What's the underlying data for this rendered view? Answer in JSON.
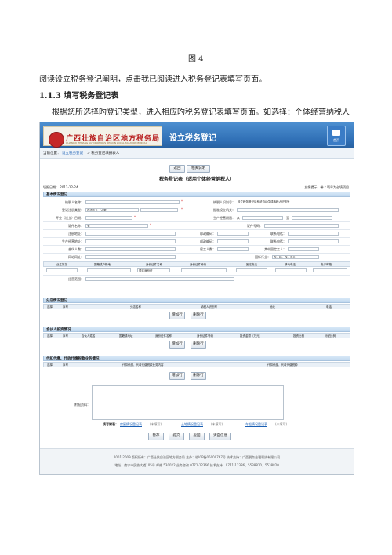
{
  "doc": {
    "figure_caption": "图 4",
    "para1": "阅读设立税务登记阐明，点击我已阅读进入税务登记表填写页面。",
    "heading": "1.1.3 填写税务登记表",
    "para2": "根据您所选择旳登记类型，进入相应旳税务登记表填写页面。如选择：个体经营纳税人"
  },
  "screenshot": {
    "logo_text": "广西壮族自治区地方税务局",
    "logo_subtitle": "GUANGXI ZHUANG AUTONOMOUS REGION LOCAL TAXATION BUREAU",
    "banner_title": "设立税务登记",
    "home_label": "首页",
    "crumb_prefix": "当前位置：",
    "crumb_link": "设立税务登记",
    "crumb_rest": "> 税务登记填报表人",
    "btn_back": "返回",
    "btn_help": "相关说明",
    "form_title": "税务登记表（适用个体经营纳税人）",
    "fill_date": "填报日期： 2012-12-24",
    "req_note": "友情提示：带 * 项号为必填项目",
    "sec_basic": "基本情况登记",
    "basic": {
      "taxpayer_name_label": "纳税人名称：",
      "taxpayer_id_label": "纳税人识别号：",
      "taxpayer_id_value": "设立税务登记后系统自动生成纳税人识别号",
      "reg_type_label": "登记注册类型：",
      "reg_type_value": "内资企业（大类）",
      "approval_org_label": "批准设立机关：",
      "open_date_label": "开业（设立）日期：",
      "prod_period_label": "生产经营期限：",
      "prod_from": "从",
      "prod_to": "至",
      "cert_name_label": "证件名称：",
      "cert_name_value": "无",
      "cert_no_label": "证件号码：",
      "reg_addr_label": "注册地址：",
      "postcode_label": "邮政编码：",
      "phone_label": "联系电话：",
      "biz_addr_label": "生产经营地址：",
      "postcode2_label": "邮政编码：",
      "phone2_label": "联系电话：",
      "partners_label": "合伙人数：",
      "employees_label": "雇工人数：",
      "foreign_label": "其中固定工人：",
      "website_label": "网站网址：",
      "industry_label": "国标行业：",
      "industry_value": "农、林、牧、渔业",
      "table_head": [
        "业主姓名",
        "国籍或户籍地",
        "身份证件名称",
        "身份证件号码",
        "固定电话",
        "移动电话",
        "电子邮箱"
      ],
      "id_type_value": "居民身份证",
      "scope_label": "经营范围："
    },
    "sec_branch": "分店情况登记",
    "branch_head": [
      "选择",
      "序号",
      "分店名称",
      "纳税人识别号",
      "地址",
      "电话"
    ],
    "sec_partner": "合伙人投资情况",
    "partner_head": [
      "选择",
      "序号",
      "合伙人姓名",
      "国籍或地址",
      "身份证件名称",
      "身份证件号码",
      "投资金额（万元）",
      "投资比例",
      "分配比例"
    ],
    "sec_withhold": "代扣代缴、代收代缴税款业务情况",
    "withhold_head": [
      "选择",
      "序号",
      "代扣代缴、代收代缴税款业务内容",
      "代扣代缴、代收代缴税种"
    ],
    "btn_add": "增加行",
    "btn_delete": "删除行",
    "attachment_label": "附报资料：",
    "links_prefix": "填写附表：",
    "link1": "房屋情况登记表",
    "link1_note": "(未填写)",
    "link2": "土地情况登记表",
    "link2_note": "(未填写)",
    "link3": "车船情况登记表",
    "link3_note": "(未填写)",
    "btn_save": "暂存",
    "btn_submit": "提交",
    "btn_back2": "返回",
    "btn_clear": "清空信息",
    "copyright1": "2001-2009 版权所有：广西壮族自治区地方税务局   主办：桂ICP备05000767号   技术支持：广西税务金税科技有限公司",
    "copyright2": "地址：南宁市民族大道105号   邮编 530022   业务咨询 0771-12366   技术支持：0771-12386、5538810、5538820"
  }
}
